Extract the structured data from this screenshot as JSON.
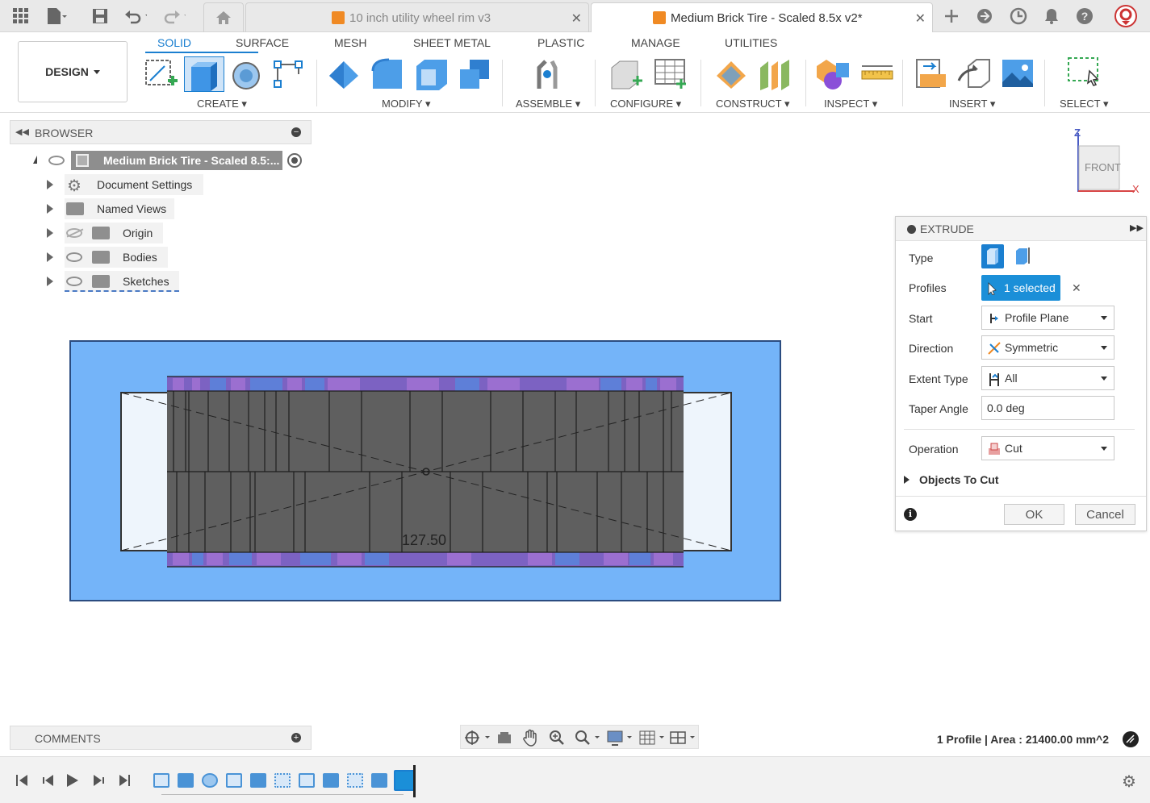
{
  "topbar": {
    "tabs": [
      {
        "title": "10 inch utility wheel rim v3",
        "active": false
      },
      {
        "title": "Medium Brick Tire - Scaled 8.5x v2*",
        "active": true
      }
    ]
  },
  "ribbon": {
    "workspace": "DESIGN",
    "tabs": [
      "SOLID",
      "SURFACE",
      "MESH",
      "SHEET METAL",
      "PLASTIC",
      "MANAGE",
      "UTILITIES"
    ],
    "groups": [
      "CREATE",
      "MODIFY",
      "ASSEMBLE",
      "CONFIGURE",
      "CONSTRUCT",
      "INSPECT",
      "INSERT",
      "SELECT"
    ]
  },
  "browser": {
    "title": "BROWSER",
    "root": "Medium Brick Tire - Scaled 8.5:...",
    "items": [
      "Document Settings",
      "Named Views",
      "Origin",
      "Bodies",
      "Sketches"
    ]
  },
  "viewcube": {
    "face": "FRONT",
    "axis_z": "Z",
    "axis_x": "X"
  },
  "viewport": {
    "dimension": "127.50"
  },
  "extrude": {
    "title": "EXTRUDE",
    "type_label": "Type",
    "profiles_label": "Profiles",
    "profiles_value": "1 selected",
    "start_label": "Start",
    "start_value": "Profile Plane",
    "direction_label": "Direction",
    "direction_value": "Symmetric",
    "extent_label": "Extent Type",
    "extent_value": "All",
    "taper_label": "Taper Angle",
    "taper_value": "0.0 deg",
    "operation_label": "Operation",
    "operation_value": "Cut",
    "objects_label": "Objects To Cut",
    "ok": "OK",
    "cancel": "Cancel"
  },
  "comments": {
    "title": "COMMENTS"
  },
  "status": {
    "text": "1 Profile | Area : 21400.00 mm^2"
  },
  "colors": {
    "accent": "#1b7fd0",
    "body": "#74b4f9",
    "purple": "#8a4fb3"
  }
}
